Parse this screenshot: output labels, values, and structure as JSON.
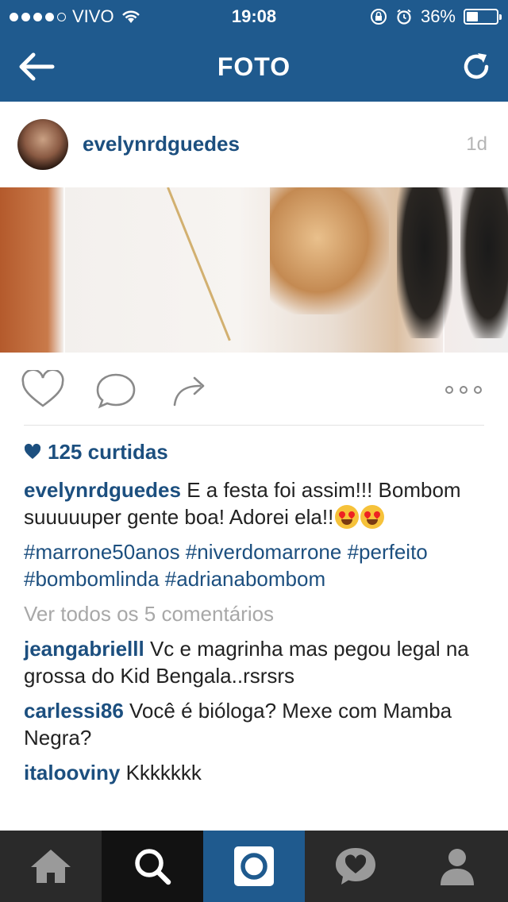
{
  "status_bar": {
    "carrier": "VIVO",
    "time": "19:08",
    "battery": "36%"
  },
  "nav": {
    "title": "FOTO",
    "back_icon": "back-arrow-icon",
    "refresh_icon": "refresh-icon",
    "color": "#1f5a8e"
  },
  "post": {
    "username": "evelynrdguedes",
    "age": "1d",
    "likes": "125 curtidas",
    "caption_user": "evelynrdguedes",
    "caption_text": " E a festa foi assim!!! Bombom suuuuuper gente boa! Adorei ela!!",
    "hashtags": "#marrone50anos #niverdomarrone #perfeito #bombomlinda #adrianabombom",
    "view_all": "Ver todos os 5 comentários",
    "comments": [
      {
        "user": "jeangabrielll",
        "text": " Vc e magrinha mas pegou legal na grossa do Kid Bengala..rsrsrs"
      },
      {
        "user": "carlessi86",
        "text": " Você é bióloga? Mexe com Mamba Negra?"
      },
      {
        "user": "italooviny",
        "text": " Kkkkkkk"
      }
    ]
  },
  "actions": {
    "like_icon": "heart-icon",
    "comment_icon": "comment-bubble-icon",
    "share_icon": "share-arrow-icon",
    "more_icon": "more-dots-icon"
  },
  "tabs": [
    {
      "name": "home",
      "icon": "home-icon"
    },
    {
      "name": "explore",
      "icon": "search-icon"
    },
    {
      "name": "camera",
      "icon": "camera-icon",
      "active": true
    },
    {
      "name": "activity",
      "icon": "activity-heart-icon"
    },
    {
      "name": "profile",
      "icon": "profile-icon"
    }
  ]
}
